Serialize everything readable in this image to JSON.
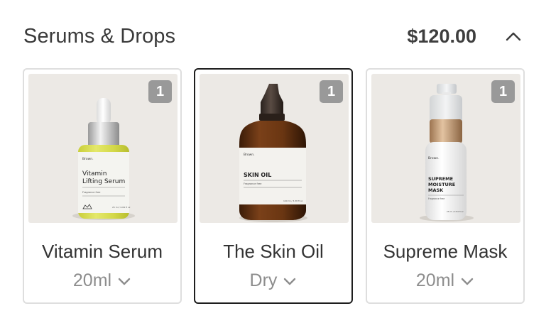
{
  "section": {
    "title": "Serums & Drops",
    "price": "$120.00",
    "toggle_icon": "chevron-up-icon"
  },
  "products": [
    {
      "name": "Vitamin Serum",
      "variant": "20ml",
      "quantity": "1",
      "selected": false,
      "image": {
        "brand": "Brown.",
        "label_line1": "Vitamin",
        "label_line2": "Lifting Serum",
        "label_small": "Fragrance free",
        "volume": "25 ml / 0.84 fl oz",
        "fill_color": "#d8dc4e"
      }
    },
    {
      "name": "The Skin Oil",
      "variant": "Dry",
      "quantity": "1",
      "selected": true,
      "image": {
        "brand": "Brown.",
        "label_line1": "SKIN OIL",
        "label_small": "Fragrance free",
        "volume": "100 ml / 3.38 fl oz",
        "fill_color": "#5e3315"
      }
    },
    {
      "name": "Supreme Mask",
      "variant": "20ml",
      "quantity": "1",
      "selected": false,
      "image": {
        "brand": "Brown.",
        "label_line1": "SUPREME",
        "label_line2": "MOISTURE",
        "label_line3": "MASK",
        "label_small": "Fragrance free",
        "volume": "25 ml / 0.84 fl oz",
        "fill_color": "#c7a07a"
      }
    }
  ]
}
